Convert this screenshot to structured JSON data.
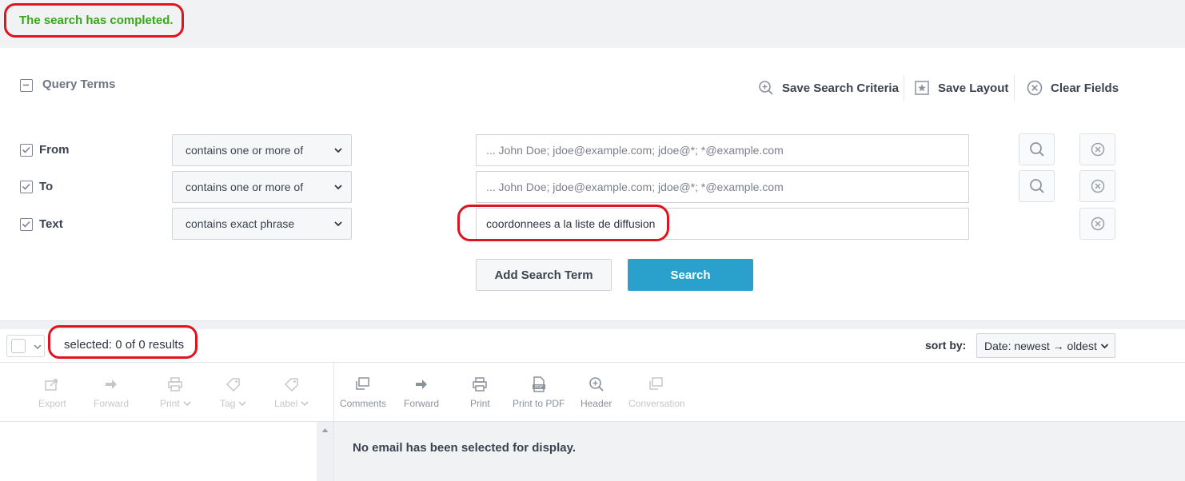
{
  "status": {
    "message": "The search has completed."
  },
  "query": {
    "section_label": "Query Terms",
    "actions": {
      "save_criteria": "Save Search Criteria",
      "save_layout": "Save Layout",
      "clear_fields": "Clear Fields"
    },
    "rows": [
      {
        "field": "From",
        "operator": "contains one or more of",
        "value": "",
        "placeholder": "... John Doe; jdoe@example.com; jdoe@*; *@example.com",
        "has_lookup": true
      },
      {
        "field": "To",
        "operator": "contains one or more of",
        "value": "",
        "placeholder": "... John Doe; jdoe@example.com; jdoe@*; *@example.com",
        "has_lookup": true
      },
      {
        "field": "Text",
        "operator": "contains exact phrase",
        "value": "coordonnees a la liste de diffusion",
        "placeholder": "",
        "has_lookup": false
      }
    ],
    "add_term_label": "Add Search Term",
    "search_label": "Search"
  },
  "results": {
    "count_text": "selected: 0 of 0 results",
    "sort_label": "sort by:",
    "sort_value": "Date: newest → oldest"
  },
  "toolbar": {
    "left": [
      {
        "label": "Export",
        "icon": "export-icon",
        "enabled": false
      },
      {
        "label": "Forward",
        "icon": "forward-icon",
        "enabled": false
      },
      {
        "label": "Print",
        "icon": "print-icon",
        "enabled": false,
        "dropdown": true
      },
      {
        "label": "Tag",
        "icon": "tag-icon",
        "enabled": false,
        "dropdown": true
      },
      {
        "label": "Label",
        "icon": "label-icon",
        "enabled": false,
        "dropdown": true
      }
    ],
    "right": [
      {
        "label": "Comments",
        "icon": "comments-icon",
        "enabled": true
      },
      {
        "label": "Forward",
        "icon": "forward-icon",
        "enabled": true
      },
      {
        "label": "Print",
        "icon": "print-icon",
        "enabled": true
      },
      {
        "label": "Print to PDF",
        "icon": "pdf-icon",
        "enabled": true
      },
      {
        "label": "Header",
        "icon": "header-zoom-icon",
        "enabled": true
      },
      {
        "label": "Conversation",
        "icon": "conversation-icon",
        "enabled": false
      }
    ]
  },
  "preview": {
    "empty_message": "No email has been selected for display."
  },
  "colors": {
    "success": "#3aa51a",
    "accent": "#2aa1cd",
    "annotation": "#e0141e"
  }
}
